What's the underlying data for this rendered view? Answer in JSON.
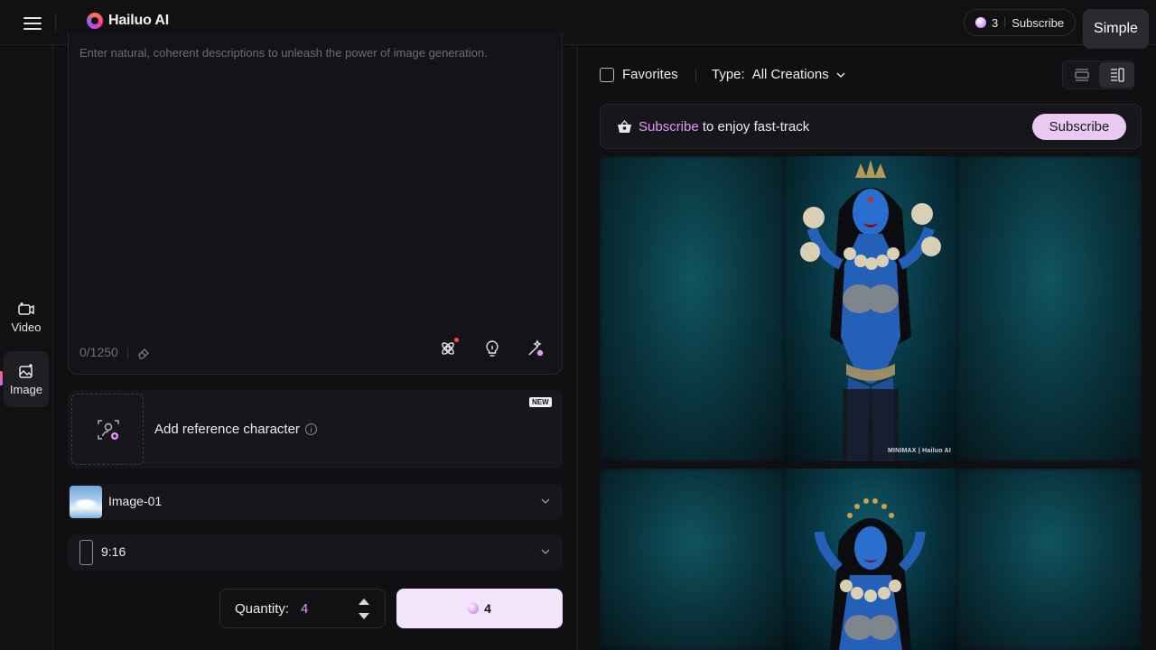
{
  "header": {
    "brand": "Hailuo AI",
    "credits": "3",
    "subscribe_label": "Subscribe",
    "mode_label": "Simple"
  },
  "nav": {
    "items": [
      {
        "label": "Video",
        "icon": "video-icon"
      },
      {
        "label": "Image",
        "icon": "image-icon",
        "active": true
      }
    ]
  },
  "prompt": {
    "placeholder": "Enter natural, coherent descriptions to unleash the power of image generation.",
    "counter": "0/1250"
  },
  "reference": {
    "label": "Add reference character",
    "badge": "NEW"
  },
  "model": {
    "selected": "Image-01"
  },
  "aspect": {
    "selected": "9:16"
  },
  "quantity": {
    "label": "Quantity:",
    "value": "4"
  },
  "generate": {
    "cost": "4"
  },
  "filters": {
    "favorites_label": "Favorites",
    "type_label": "Type:",
    "type_value": "All Creations"
  },
  "banner": {
    "link_text": "Subscribe",
    "text": " to enjoy fast-track",
    "button_label": "Subscribe"
  },
  "gallery": {
    "watermark": "MINIMAX | Hailuo AI"
  },
  "colors": {
    "accent": "#e497ff",
    "generate_bg": "#f4e4fb",
    "subscribe_bg": "#e9c9f2",
    "background": "#101013"
  }
}
